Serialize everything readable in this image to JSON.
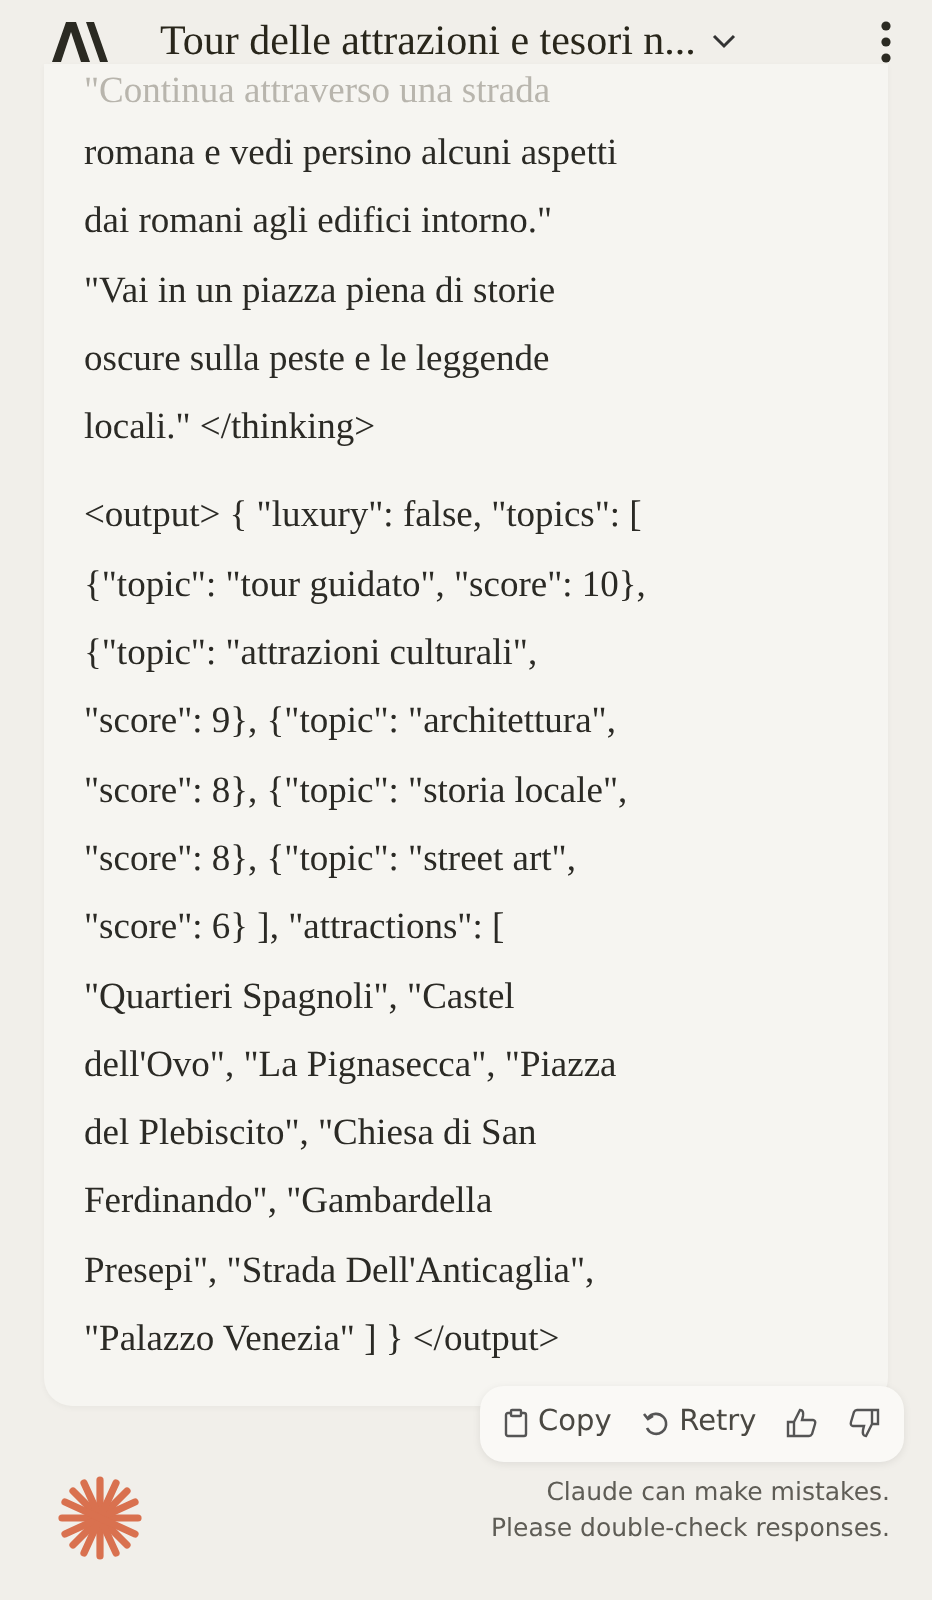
{
  "header": {
    "title": "Tour delle attrazioni e tesori n..."
  },
  "message": {
    "faded_line": "\"Continua attraverso una strada",
    "paragraphs": [
      [
        "romana e vedi persino alcuni aspetti",
        "dai romani agli edifici intorno.\"",
        "\"Vai in un piazza piena di storie",
        "oscure sulla peste e le leggende",
        "locali.\" </thinking>"
      ],
      [
        "<output> { \"luxury\": false, \"topics\": [",
        "{\"topic\": \"tour guidato\", \"score\": 10},",
        "{\"topic\": \"attrazioni culturali\",",
        "\"score\": 9}, {\"topic\": \"architettura\",",
        "\"score\": 8}, {\"topic\": \"storia locale\",",
        "\"score\": 8}, {\"topic\": \"street art\",",
        "\"score\": 6} ], \"attractions\": [",
        "\"Quartieri Spagnoli\", \"Castel",
        "dell'Ovo\", \"La Pignasecca\", \"Piazza",
        "del Plebiscito\", \"Chiesa di San",
        "Ferdinando\", \"Gambardella",
        "Presepi\", \"Strada Dell'Anticaglia\",",
        "\"Palazzo Venezia\" ] } </output>"
      ]
    ]
  },
  "actions": {
    "copy": "Copy",
    "retry": "Retry"
  },
  "disclaimer": [
    "Claude can make mistakes.",
    "Please double-check responses."
  ]
}
